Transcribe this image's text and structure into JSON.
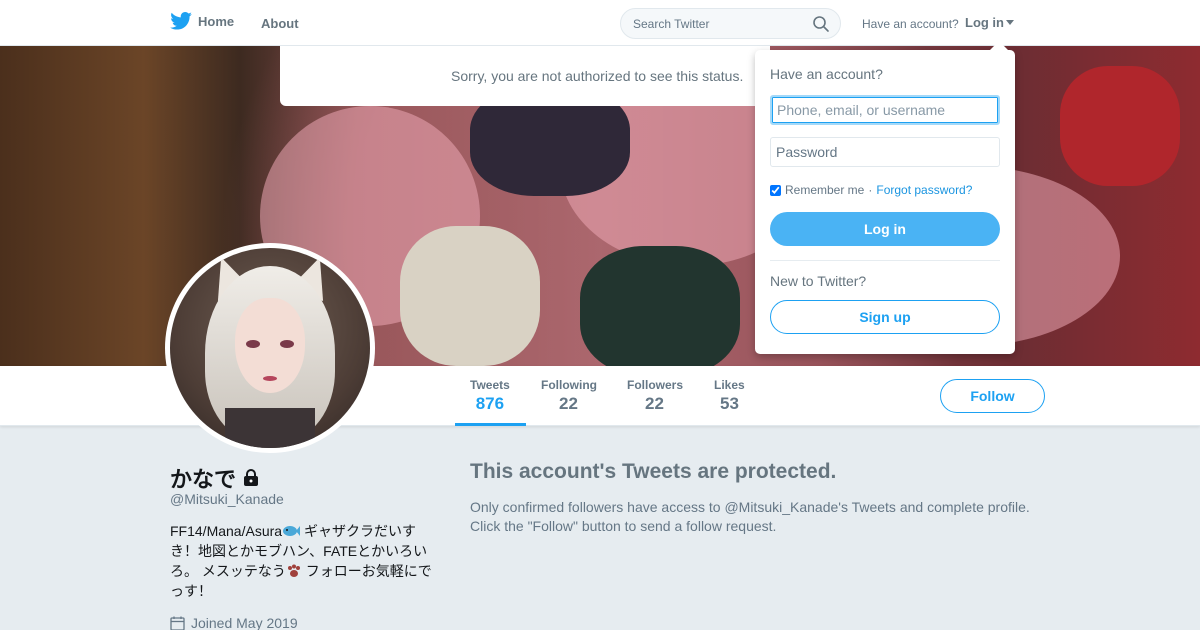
{
  "nav": {
    "home_label": "Home",
    "about_label": "About",
    "search_placeholder": "Search Twitter",
    "have_account_text": "Have an account?",
    "login_label": "Log in"
  },
  "notice": {
    "text": "Sorry, you are not authorized to see this status."
  },
  "login_dropdown": {
    "heading": "Have an account?",
    "username_placeholder": "Phone, email, or username",
    "password_placeholder": "Password",
    "remember_label": "Remember me",
    "separator": "·",
    "forgot_label": "Forgot password?",
    "remember_checked": true,
    "login_button": "Log in",
    "new_heading": "New to Twitter?",
    "signup_button": "Sign up"
  },
  "profile_nav": {
    "stats": [
      {
        "label": "Tweets",
        "value": "876"
      },
      {
        "label": "Following",
        "value": "22"
      },
      {
        "label": "Followers",
        "value": "22"
      },
      {
        "label": "Likes",
        "value": "53"
      }
    ],
    "follow_button": "Follow"
  },
  "profile": {
    "name": "かなで",
    "handle": "@Mitsuki_Kanade",
    "bio_part1": "FF14/Mana/Asura",
    "bio_part2": " ギャザクラだいすき！地図とかモブハン、FATEとかいろいろ。 メスッテなう",
    "bio_part3": " フォローお気軽にでっす！",
    "joined": "Joined May 2019"
  },
  "protected": {
    "title": "This account's Tweets are protected.",
    "line1": "Only confirmed followers have access to @Mitsuki_Kanade's Tweets and complete profile.",
    "line2": "Click the \"Follow\" button to send a follow request."
  },
  "colors": {
    "accent": "#1da1f2",
    "login_button": "#4ab3f4",
    "background": "#e6ecf0"
  }
}
